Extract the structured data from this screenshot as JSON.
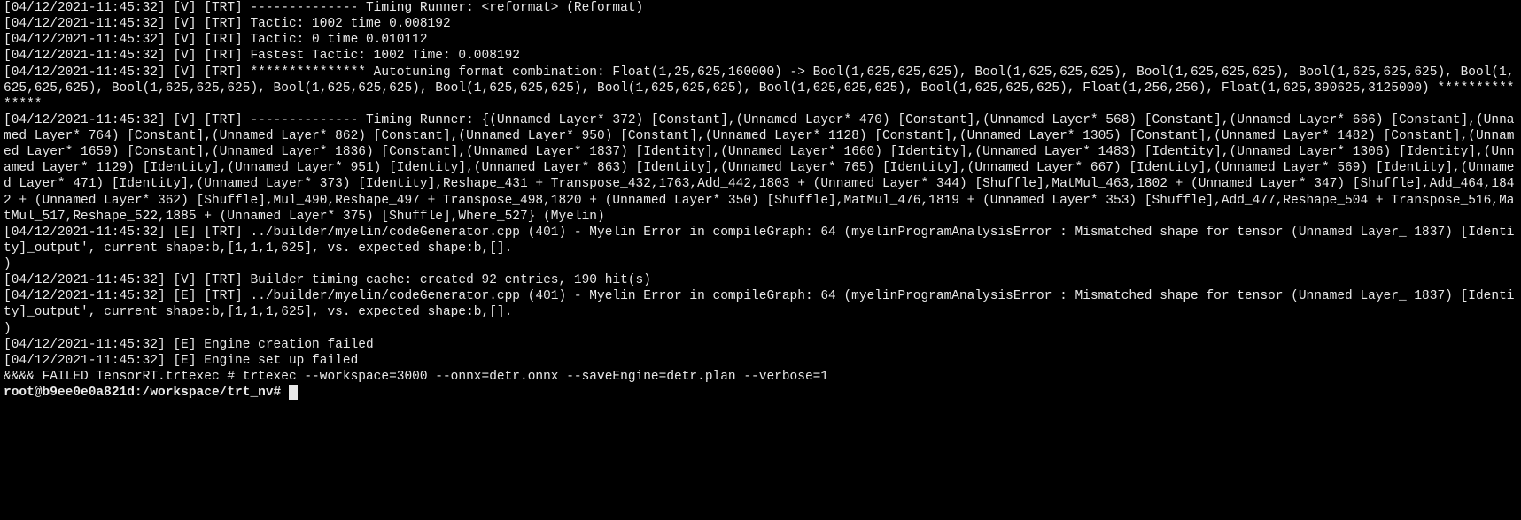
{
  "lines": {
    "l0": "[04/12/2021-11:45:32] [V] [TRT] -------------- Timing Runner: <reformat> (Reformat)",
    "l1": "[04/12/2021-11:45:32] [V] [TRT] Tactic: 1002 time 0.008192",
    "l2": "[04/12/2021-11:45:32] [V] [TRT] Tactic: 0 time 0.010112",
    "l3": "[04/12/2021-11:45:32] [V] [TRT] Fastest Tactic: 1002 Time: 0.008192",
    "l4": "[04/12/2021-11:45:32] [V] [TRT] *************** Autotuning format combination: Float(1,25,625,160000) -> Bool(1,625,625,625), Bool(1,625,625,625), Bool(1,625,625,625), Bool(1,625,625,625), Bool(1,625,625,625), Bool(1,625,625,625), Bool(1,625,625,625), Bool(1,625,625,625), Bool(1,625,625,625), Bool(1,625,625,625), Bool(1,625,625,625), Float(1,256,256), Float(1,625,390625,3125000) ***************",
    "l5": "[04/12/2021-11:45:32] [V] [TRT] -------------- Timing Runner: {(Unnamed Layer* 372) [Constant],(Unnamed Layer* 470) [Constant],(Unnamed Layer* 568) [Constant],(Unnamed Layer* 666) [Constant],(Unnamed Layer* 764) [Constant],(Unnamed Layer* 862) [Constant],(Unnamed Layer* 950) [Constant],(Unnamed Layer* 1128) [Constant],(Unnamed Layer* 1305) [Constant],(Unnamed Layer* 1482) [Constant],(Unnamed Layer* 1659) [Constant],(Unnamed Layer* 1836) [Constant],(Unnamed Layer* 1837) [Identity],(Unnamed Layer* 1660) [Identity],(Unnamed Layer* 1483) [Identity],(Unnamed Layer* 1306) [Identity],(Unnamed Layer* 1129) [Identity],(Unnamed Layer* 951) [Identity],(Unnamed Layer* 863) [Identity],(Unnamed Layer* 765) [Identity],(Unnamed Layer* 667) [Identity],(Unnamed Layer* 569) [Identity],(Unnamed Layer* 471) [Identity],(Unnamed Layer* 373) [Identity],Reshape_431 + Transpose_432,1763,Add_442,1803 + (Unnamed Layer* 344) [Shuffle],MatMul_463,1802 + (Unnamed Layer* 347) [Shuffle],Add_464,1842 + (Unnamed Layer* 362) [Shuffle],Mul_490,Reshape_497 + Transpose_498,1820 + (Unnamed Layer* 350) [Shuffle],MatMul_476,1819 + (Unnamed Layer* 353) [Shuffle],Add_477,Reshape_504 + Transpose_516,MatMul_517,Reshape_522,1885 + (Unnamed Layer* 375) [Shuffle],Where_527} (Myelin)",
    "l6": "[04/12/2021-11:45:32] [E] [TRT] ../builder/myelin/codeGenerator.cpp (401) - Myelin Error in compileGraph: 64 (myelinProgramAnalysisError : Mismatched shape for tensor (Unnamed Layer_ 1837) [Identity]_output', current shape:b,[1,1,1,625], vs. expected shape:b,[].",
    "l7": ")",
    "l8": "[04/12/2021-11:45:32] [V] [TRT] Builder timing cache: created 92 entries, 190 hit(s)",
    "l9": "[04/12/2021-11:45:32] [E] [TRT] ../builder/myelin/codeGenerator.cpp (401) - Myelin Error in compileGraph: 64 (myelinProgramAnalysisError : Mismatched shape for tensor (Unnamed Layer_ 1837) [Identity]_output', current shape:b,[1,1,1,625], vs. expected shape:b,[].",
    "l10": ")",
    "l11": "[04/12/2021-11:45:32] [E] Engine creation failed",
    "l12": "[04/12/2021-11:45:32] [E] Engine set up failed",
    "l13": "&&&& FAILED TensorRT.trtexec # trtexec --workspace=3000 --onnx=detr.onnx --saveEngine=detr.plan --verbose=1",
    "prompt": "root@b9ee0e0a821d:/workspace/trt_nv# "
  }
}
